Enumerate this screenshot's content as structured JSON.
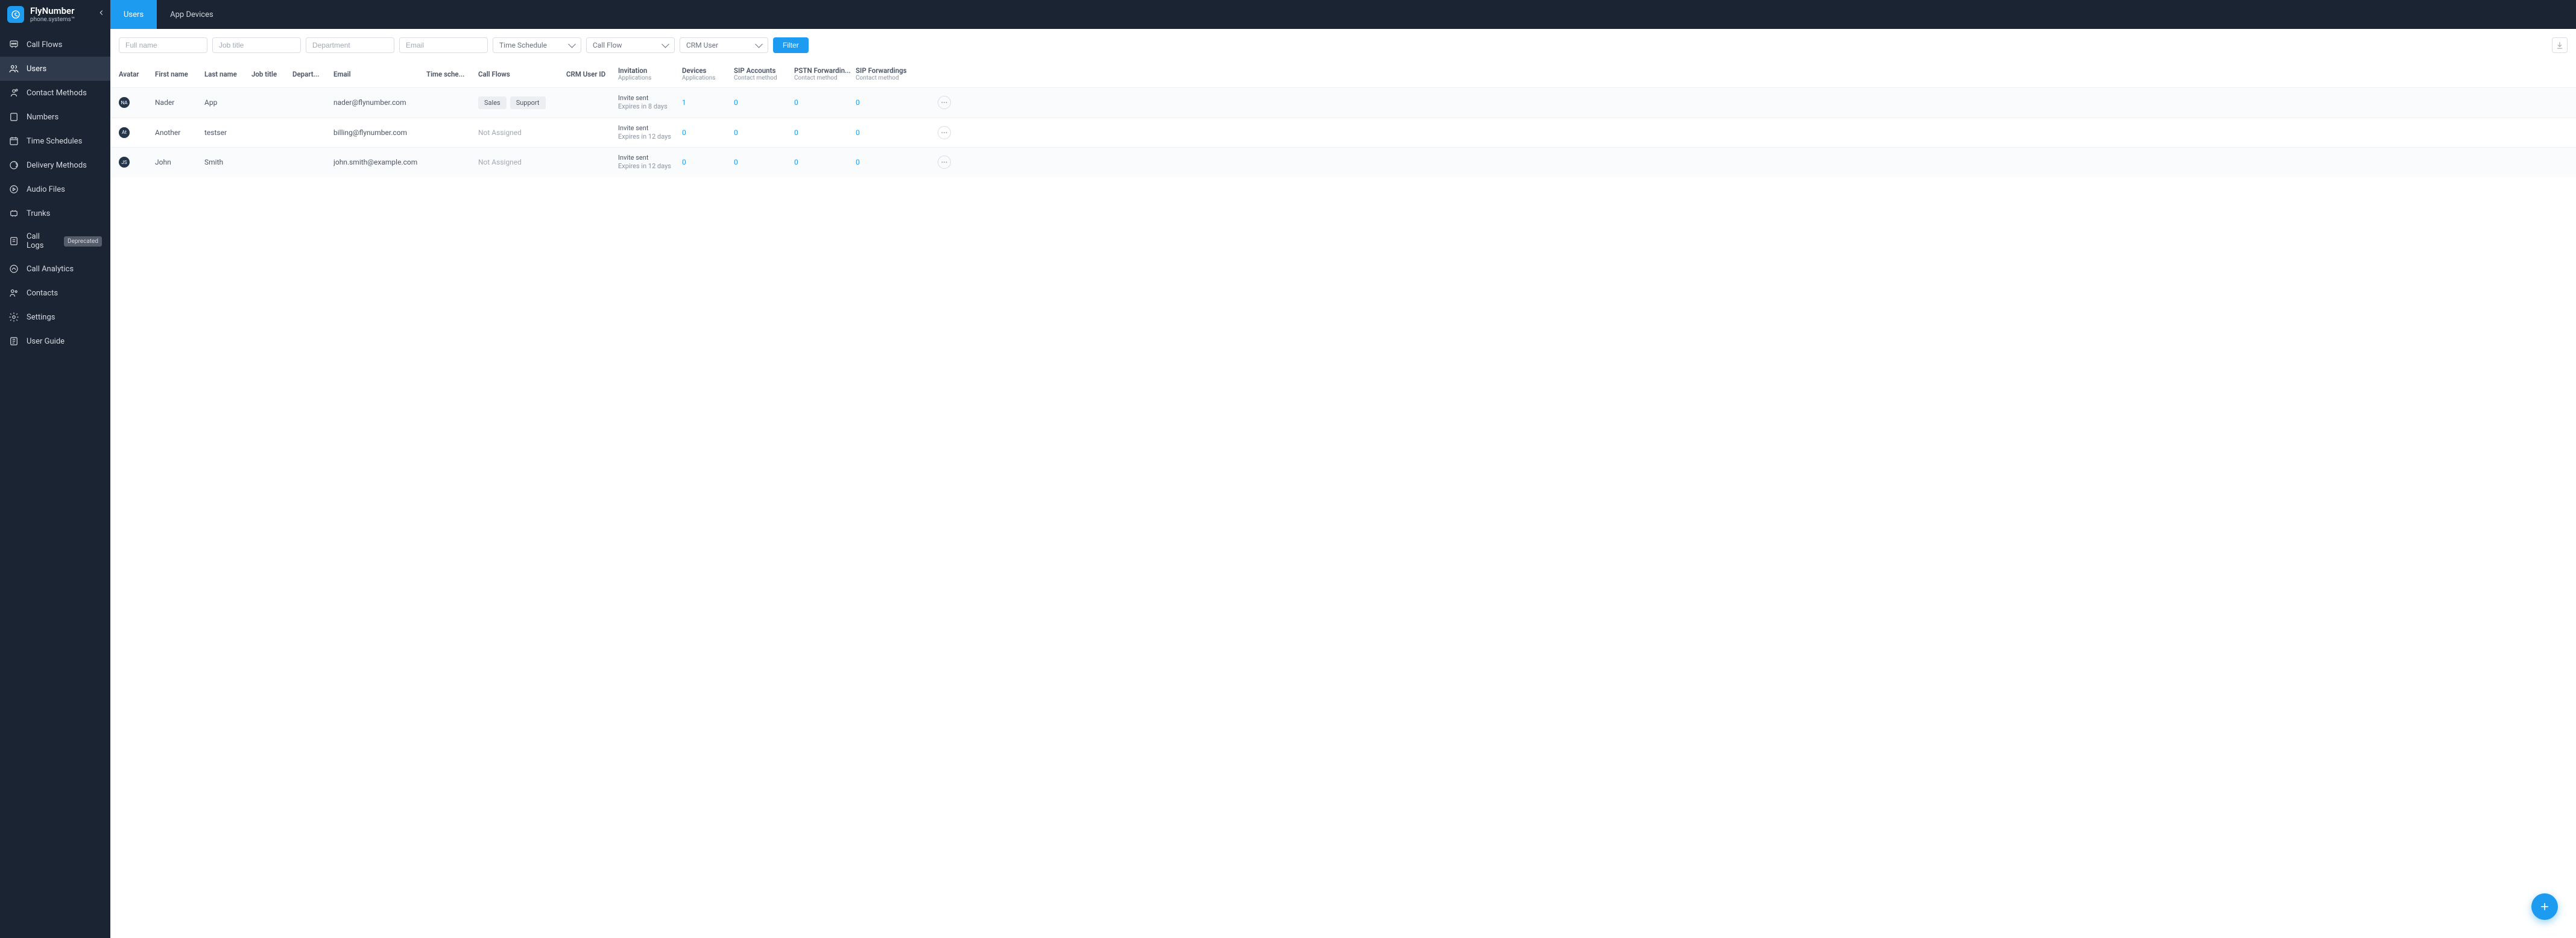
{
  "brand": {
    "title": "FlyNumber",
    "subtitle": "phone.systems™"
  },
  "sidebar": {
    "items": [
      {
        "label": "Call Flows"
      },
      {
        "label": "Users"
      },
      {
        "label": "Contact Methods"
      },
      {
        "label": "Numbers"
      },
      {
        "label": "Time Schedules"
      },
      {
        "label": "Delivery Methods"
      },
      {
        "label": "Audio Files"
      },
      {
        "label": "Trunks"
      },
      {
        "label": "Call Logs",
        "badge": "Deprecated"
      },
      {
        "label": "Call Analytics"
      },
      {
        "label": "Contacts"
      },
      {
        "label": "Settings"
      },
      {
        "label": "User Guide"
      }
    ]
  },
  "tabs": [
    {
      "label": "Users",
      "active": true
    },
    {
      "label": "App Devices",
      "active": false
    }
  ],
  "filters": {
    "full_name_ph": "Full name",
    "job_title_ph": "Job title",
    "department_ph": "Department",
    "email_ph": "Email",
    "time_schedule_label": "Time Schedule",
    "call_flow_label": "Call Flow",
    "crm_user_label": "CRM User",
    "filter_label": "Filter"
  },
  "columns": {
    "avatar": "Avatar",
    "first_name": "First name",
    "last_name": "Last name",
    "job_title": "Job title",
    "department": "Depart...",
    "email": "Email",
    "time_schedule": "Time sche...",
    "call_flows": "Call Flows",
    "crm_user_id": "CRM User ID",
    "invitation": "Invitation",
    "invitation_sub": "Applications",
    "devices": "Devices",
    "devices_sub": "Applications",
    "sip_accounts": "SIP Accounts",
    "sip_accounts_sub": "Contact method",
    "pstn": "PSTN Forwardin...",
    "pstn_sub": "Contact method",
    "sip_fwd": "SIP Forwardings",
    "sip_fwd_sub": "Contact method"
  },
  "rows": [
    {
      "avatar": "NA",
      "first_name": "Nader",
      "last_name": "App",
      "job_title": "",
      "department": "",
      "email": "nader@flynumber.com",
      "time_schedule": "",
      "call_flows": [
        "Sales",
        "Support"
      ],
      "crm_user_id": "",
      "invite_status": "Invite sent",
      "invite_expires": "Expires in 8 days",
      "devices": "1",
      "sip_accounts": "0",
      "pstn": "0",
      "sip_fwd": "0"
    },
    {
      "avatar": "At",
      "first_name": "Another",
      "last_name": "testser",
      "job_title": "",
      "department": "",
      "email": "billing@flynumber.com",
      "time_schedule": "",
      "call_flows_text": "Not Assigned",
      "crm_user_id": "",
      "invite_status": "Invite sent",
      "invite_expires": "Expires in 12 days",
      "devices": "0",
      "sip_accounts": "0",
      "pstn": "0",
      "sip_fwd": "0"
    },
    {
      "avatar": "JS",
      "first_name": "John",
      "last_name": "Smith",
      "job_title": "",
      "department": "",
      "email": "john.smith@example.com",
      "time_schedule": "",
      "call_flows_text": "Not Assigned",
      "crm_user_id": "",
      "invite_status": "Invite sent",
      "invite_expires": "Expires in 12 days",
      "devices": "0",
      "sip_accounts": "0",
      "pstn": "0",
      "sip_fwd": "0"
    }
  ]
}
